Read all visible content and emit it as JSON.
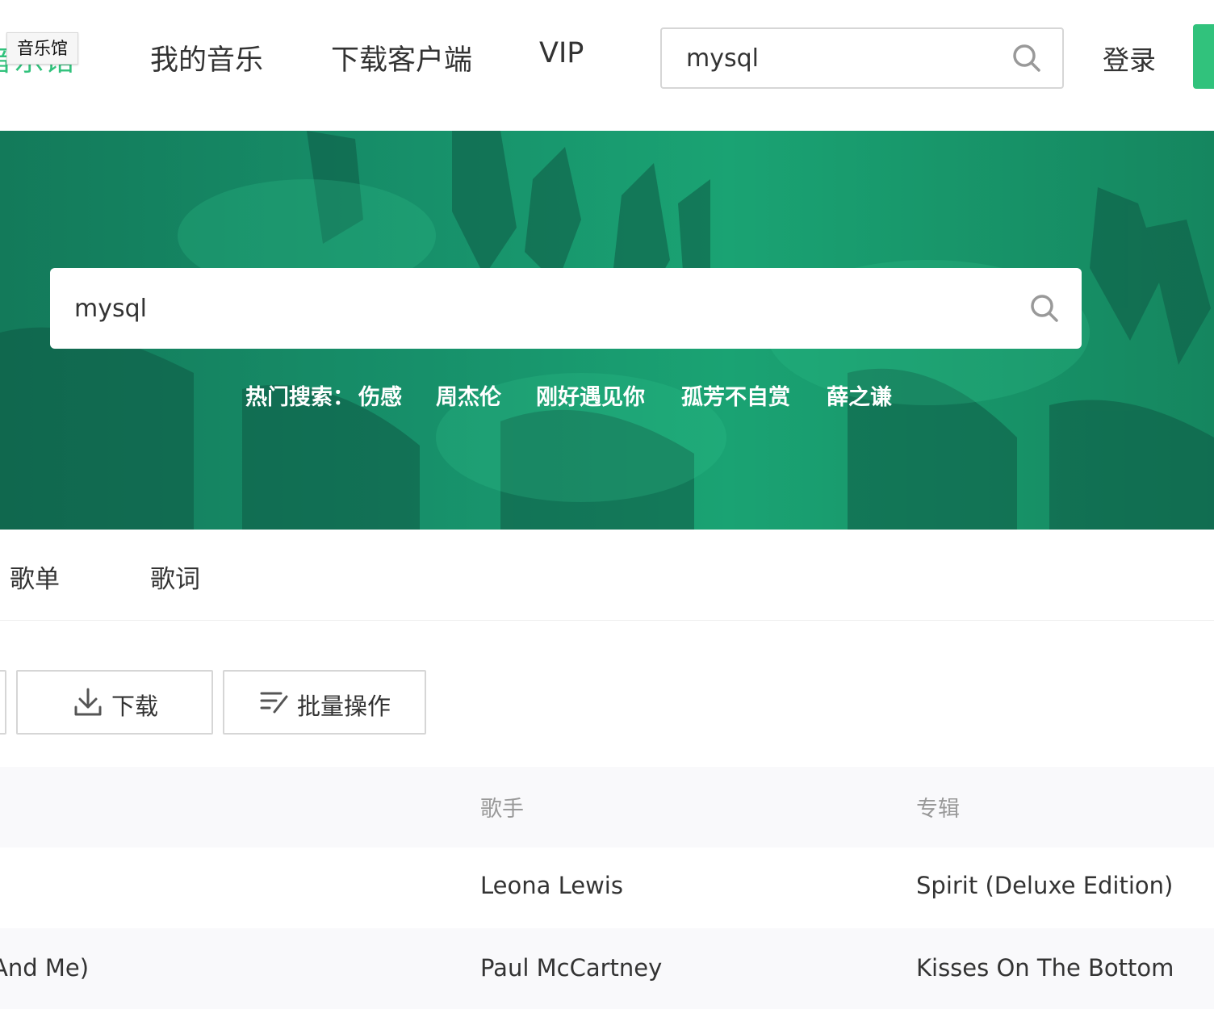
{
  "header": {
    "logo_text": "音乐馆",
    "tooltip": "音乐馆",
    "nav": [
      "我的音乐",
      "下载客户端",
      "VIP"
    ],
    "search_value": "mysql",
    "login": "登录"
  },
  "banner": {
    "search_value": "mysql",
    "hot_label": "热门搜索：",
    "hot_items": [
      "伤感",
      "周杰伦",
      "刚好遇见你",
      "孤芳不自赏",
      "薛之谦"
    ]
  },
  "tabs": [
    "歌单",
    "歌词"
  ],
  "toolbar": {
    "download": "下载",
    "batch": "批量操作"
  },
  "table": {
    "headers": {
      "singer": "歌手",
      "album": "专辑"
    },
    "rows": [
      {
        "song": "",
        "singer": "Leona Lewis",
        "album": "Spirit (Deluxe Edition)"
      },
      {
        "song": "And Me)",
        "singer": "Paul McCartney",
        "album": "Kisses On The Bottom"
      }
    ]
  },
  "colors": {
    "brand_green": "#31c27c",
    "banner_green": "#17906a"
  }
}
